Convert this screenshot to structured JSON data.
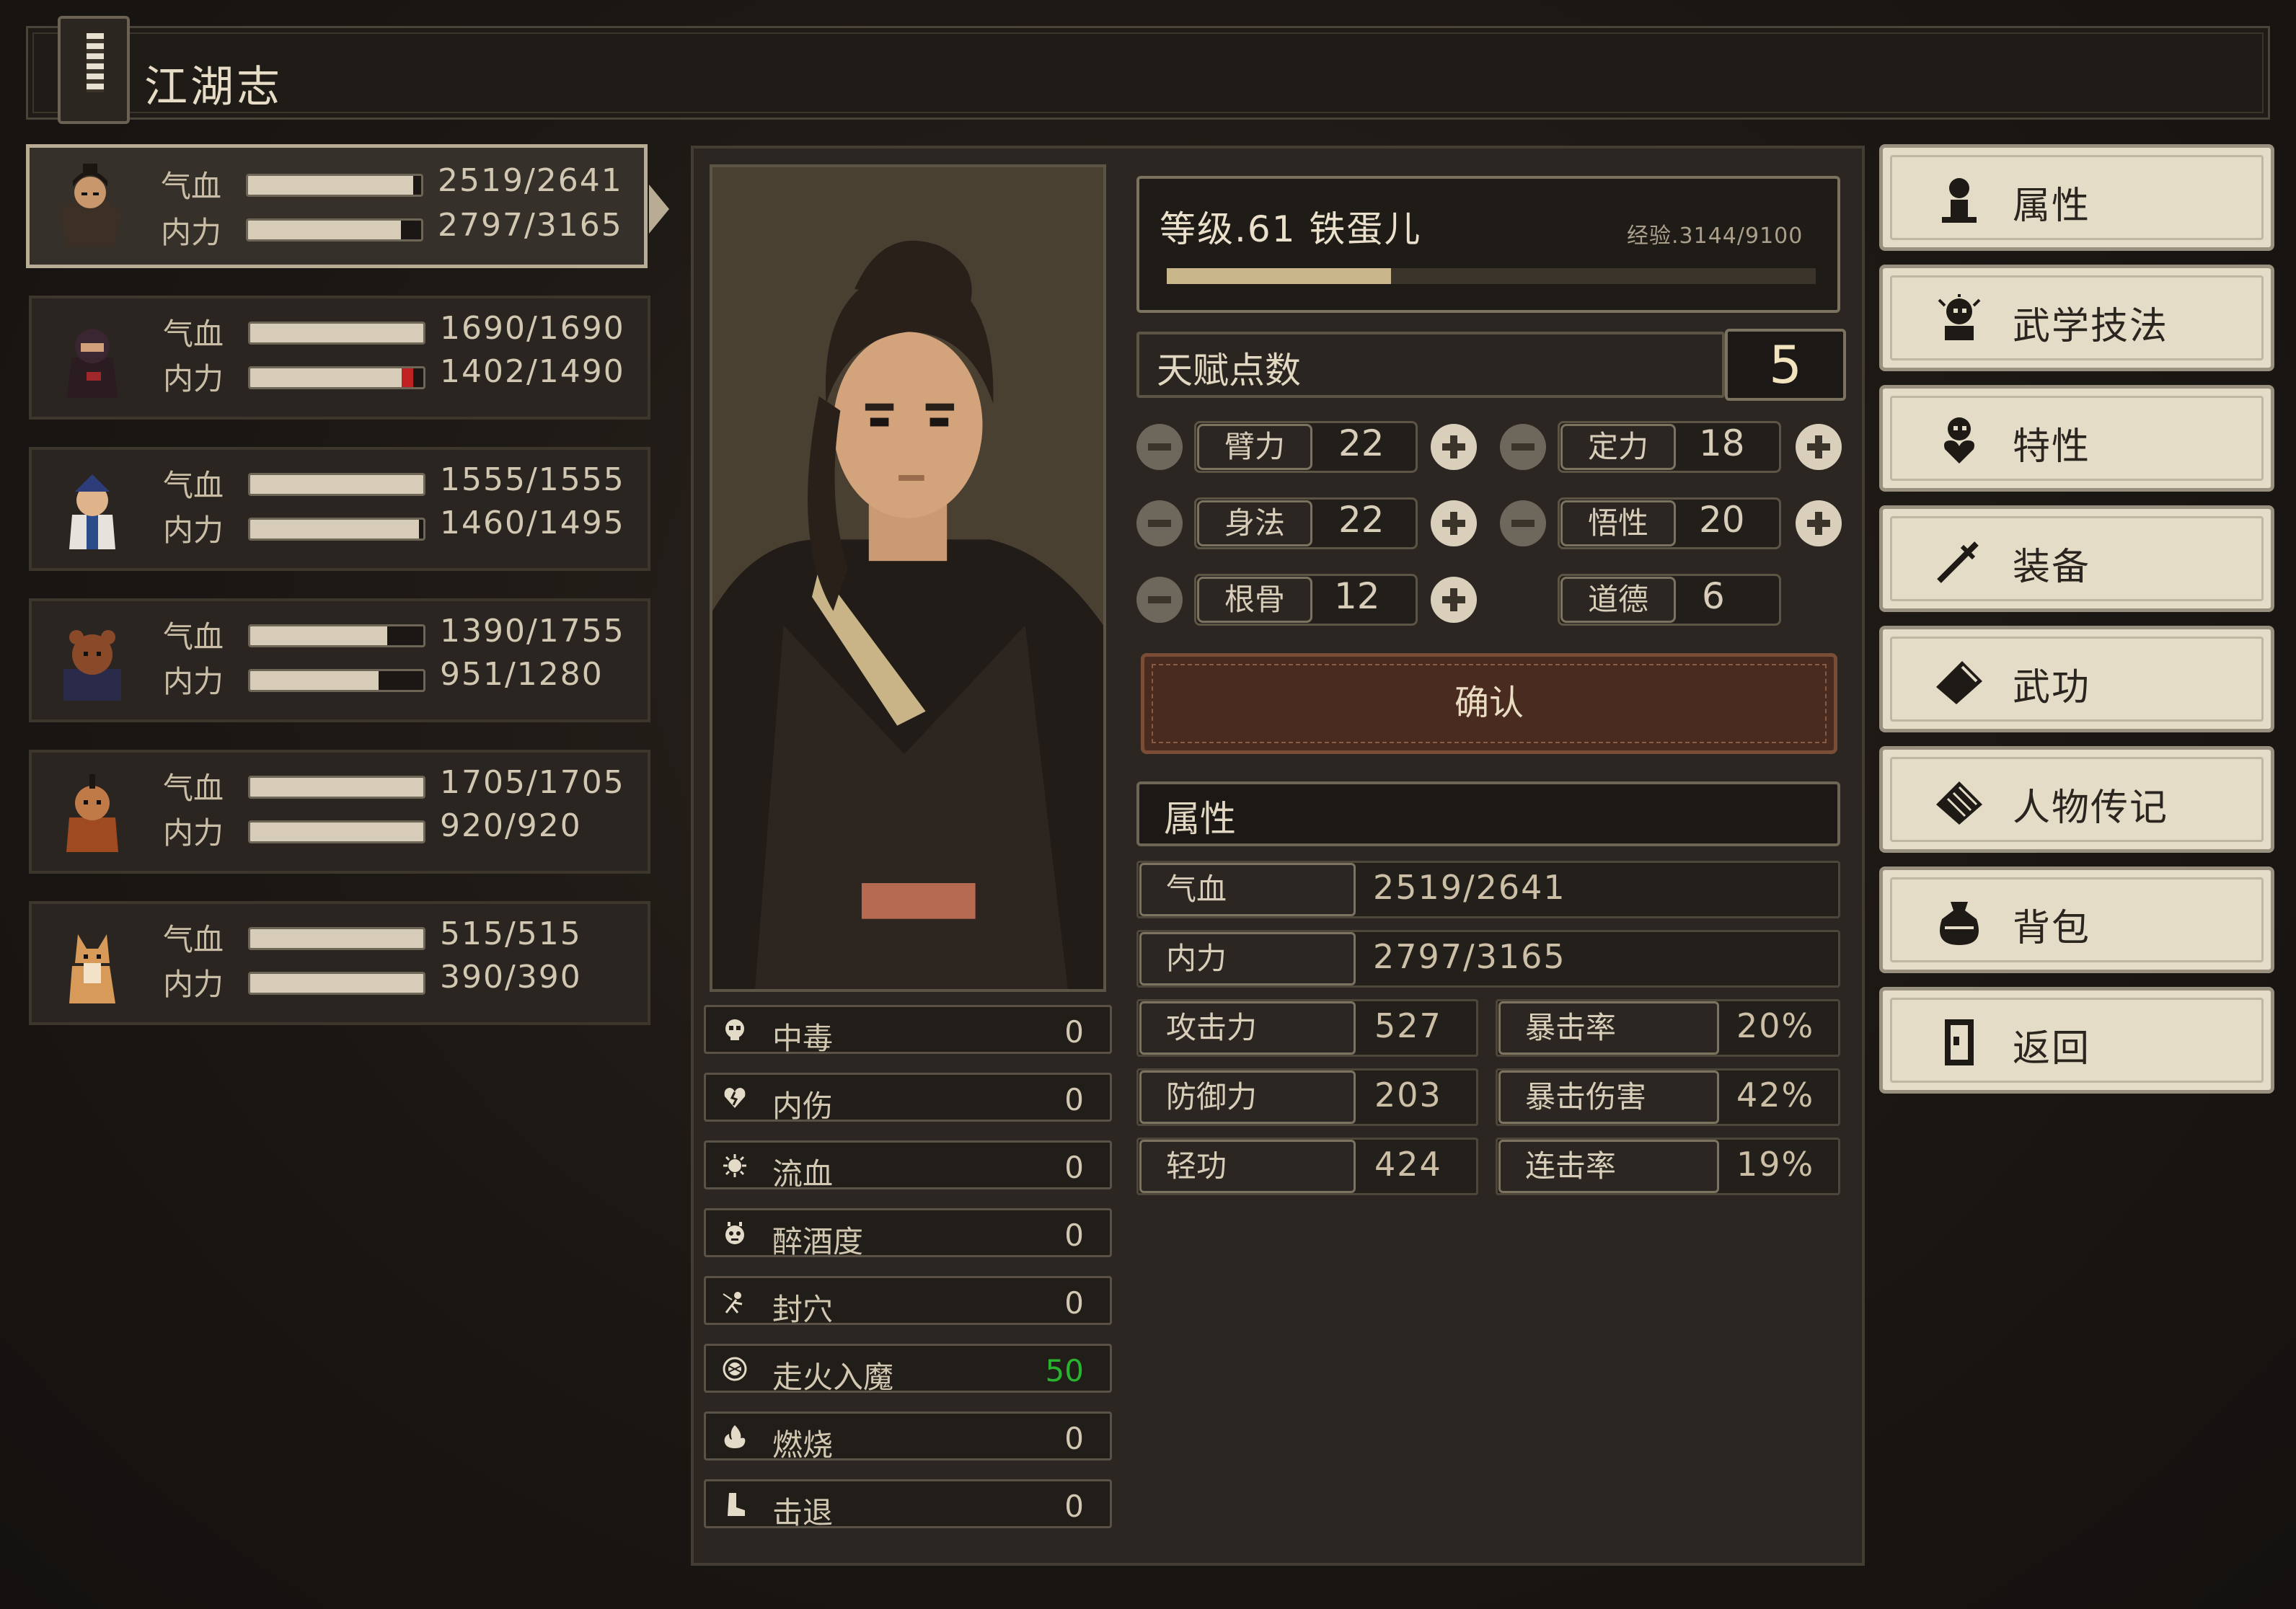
{
  "app": {
    "title": "江湖志"
  },
  "party": [
    {
      "hp_label": "气血",
      "mp_label": "内力",
      "hp": "2519/2641",
      "mp": "2797/3165",
      "hp_ratio": 0.954,
      "mp_ratio": 0.884
    },
    {
      "hp_label": "气血",
      "mp_label": "内力",
      "hp": "1690/1690",
      "mp": "1402/1490",
      "hp_ratio": 1.0,
      "mp_ratio": 0.941
    },
    {
      "hp_label": "气血",
      "mp_label": "内力",
      "hp": "1555/1555",
      "mp": "1460/1495",
      "hp_ratio": 1.0,
      "mp_ratio": 0.977
    },
    {
      "hp_label": "气血",
      "mp_label": "内力",
      "hp": "1390/1755",
      "mp": "951/1280",
      "hp_ratio": 0.792,
      "mp_ratio": 0.743
    },
    {
      "hp_label": "气血",
      "mp_label": "内力",
      "hp": "1705/1705",
      "mp": "920/920",
      "hp_ratio": 1.0,
      "mp_ratio": 1.0
    },
    {
      "hp_label": "气血",
      "mp_label": "内力",
      "hp": "515/515",
      "mp": "390/390",
      "hp_ratio": 1.0,
      "mp_ratio": 1.0
    }
  ],
  "character": {
    "level_label": "等级.61 铁蛋儿",
    "exp_label": "经验.3144/9100",
    "exp_ratio": 0.345
  },
  "talent": {
    "label": "天赋点数",
    "points": "5"
  },
  "stats": [
    {
      "name": "臂力",
      "value": "22"
    },
    {
      "name": "定力",
      "value": "18"
    },
    {
      "name": "身法",
      "value": "22"
    },
    {
      "name": "悟性",
      "value": "20"
    },
    {
      "name": "根骨",
      "value": "12"
    },
    {
      "name": "道德",
      "value": "6"
    }
  ],
  "confirm_label": "确认",
  "attributes": {
    "title": "属性",
    "hp": {
      "label": "气血",
      "value": "2519/2641"
    },
    "mp": {
      "label": "内力",
      "value": "2797/3165"
    },
    "grid": [
      {
        "label": "攻击力",
        "value": "527"
      },
      {
        "label": "暴击率",
        "value": "20%"
      },
      {
        "label": "防御力",
        "value": "203"
      },
      {
        "label": "暴击伤害",
        "value": "42%"
      },
      {
        "label": "轻功",
        "value": "424"
      },
      {
        "label": "连击率",
        "value": "19%"
      }
    ]
  },
  "statuses": [
    {
      "name": "中毒",
      "value": "0",
      "icon": "poison-icon"
    },
    {
      "name": "内伤",
      "value": "0",
      "icon": "broken-heart-icon"
    },
    {
      "name": "流血",
      "value": "0",
      "icon": "blood-icon"
    },
    {
      "name": "醉酒度",
      "value": "0",
      "icon": "drunk-icon"
    },
    {
      "name": "封穴",
      "value": "0",
      "icon": "acupoint-icon"
    },
    {
      "name": "走火入魔",
      "value": "50",
      "icon": "qi-deviation-icon",
      "color": "#28b42f"
    },
    {
      "name": "燃烧",
      "value": "0",
      "icon": "fire-icon"
    },
    {
      "name": "击退",
      "value": "0",
      "icon": "boot-icon"
    }
  ],
  "menu": [
    {
      "label": "属性",
      "icon": "attributes-icon"
    },
    {
      "label": "武学技法",
      "icon": "martial-skill-icon"
    },
    {
      "label": "特性",
      "icon": "traits-icon"
    },
    {
      "label": "装备",
      "icon": "sword-icon"
    },
    {
      "label": "武功",
      "icon": "scroll-icon"
    },
    {
      "label": "人物传记",
      "icon": "biography-icon"
    },
    {
      "label": "背包",
      "icon": "bag-icon"
    },
    {
      "label": "返回",
      "icon": "door-icon"
    }
  ]
}
